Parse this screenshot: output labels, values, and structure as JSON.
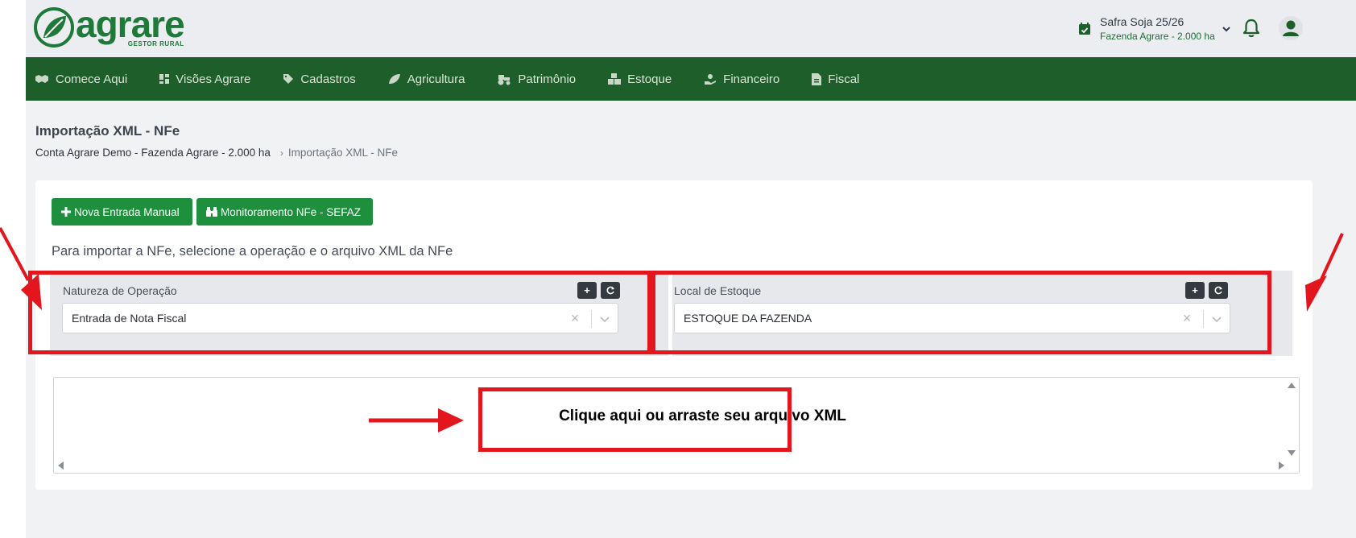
{
  "brand": {
    "name": "agrare",
    "tagline": "GESTOR RURAL",
    "color": "#1f7a3a"
  },
  "header": {
    "season_title": "Safra Soja 25/26",
    "season_farm": "Fazenda Agrare - 2.000 ha",
    "icons": [
      "calendar-check-icon",
      "chevron-down-icon",
      "bell-icon",
      "user-icon"
    ]
  },
  "nav": {
    "background": "#1e5e2a",
    "items": [
      {
        "label": "Comece Aqui",
        "icon": "handshake-icon"
      },
      {
        "label": "Visões Agrare",
        "icon": "dashboard-icon"
      },
      {
        "label": "Cadastros",
        "icon": "tags-icon"
      },
      {
        "label": "Agricultura",
        "icon": "leaf-icon"
      },
      {
        "label": "Patrimônio",
        "icon": "tractor-icon"
      },
      {
        "label": "Estoque",
        "icon": "boxes-icon"
      },
      {
        "label": "Financeiro",
        "icon": "hand-coin-icon"
      },
      {
        "label": "Fiscal",
        "icon": "invoice-icon"
      }
    ]
  },
  "page": {
    "title": "Importação XML - NFe",
    "breadcrumb": {
      "parent": "Conta Agrare Demo - Fazenda Agrare - 2.000 ha",
      "current": "Importação XML - NFe"
    }
  },
  "actions": {
    "nova_entrada": "Nova Entrada Manual",
    "monitoramento": "Monitoramento NFe - SEFAZ",
    "button_color": "#1e8f3c"
  },
  "form": {
    "instruction": "Para importar a NFe, selecione a operação e o arquivo XML da NFe",
    "natureza": {
      "label": "Natureza de Operação",
      "value": "Entrada de Nota Fiscal"
    },
    "local": {
      "label": "Local de Estoque",
      "value": "ESTOQUE DA FAZENDA"
    },
    "add_symbol": "+",
    "clear_symbol": "×"
  },
  "dropzone": {
    "text": "Clique aqui ou arraste seu arquivo XML"
  },
  "annotations": {
    "color": "#e3161e"
  }
}
